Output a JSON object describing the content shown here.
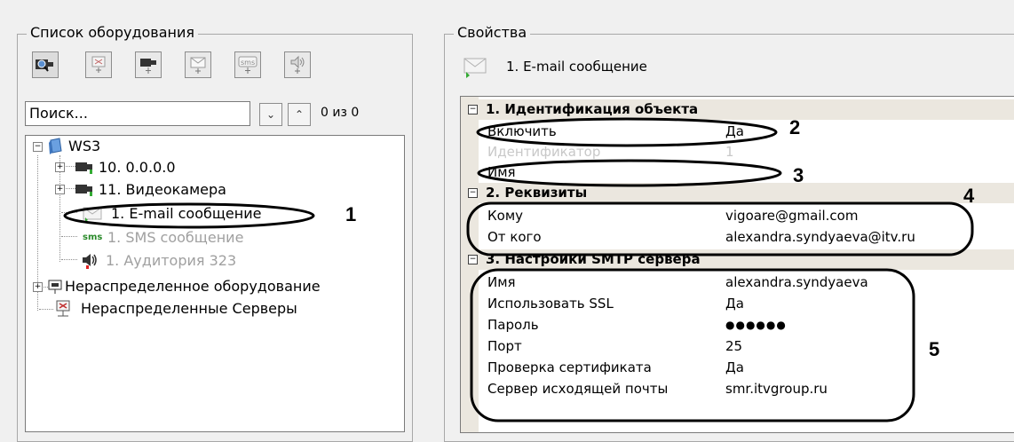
{
  "equipment": {
    "title": "Список оборудования",
    "toolbar_icons": [
      "camera-search-icon",
      "add-server-icon",
      "add-camera-icon",
      "add-email-icon",
      "add-sms-icon",
      "add-sound-icon"
    ],
    "search": {
      "value": "Поиск...",
      "count": "0 из 0"
    },
    "tree": {
      "root": "WS3",
      "items": [
        {
          "label": "10. 0.0.0.0"
        },
        {
          "label": "11. Видеокамера"
        },
        {
          "label": "1. E-mail сообщение"
        },
        {
          "label": "1. SMS сообщение"
        },
        {
          "label": "1. Аудитория 323"
        }
      ],
      "unassigned_equipment": "Нераспределенное оборудование",
      "unassigned_servers": "Нераспределенные Серверы"
    }
  },
  "properties": {
    "title": "Свойства",
    "object_title": "1. E-mail сообщение",
    "categories": [
      {
        "label": "1. Идентификация объекта",
        "rows": [
          {
            "key": "Включить",
            "value": "Да"
          },
          {
            "key": "Идентификатор",
            "value": "1"
          },
          {
            "key": "Имя",
            "value": ""
          }
        ]
      },
      {
        "label": "2. Реквизиты",
        "rows": [
          {
            "key": "Кому",
            "value": "vigoare@gmail.com"
          },
          {
            "key": "От кого",
            "value": "alexandra.syndyaeva@itv.ru"
          }
        ]
      },
      {
        "label": "3. Настройки SMTP сервера",
        "rows": [
          {
            "key": "Имя",
            "value": "alexandra.syndyaeva"
          },
          {
            "key": "Использовать SSL",
            "value": "Да"
          },
          {
            "key": "Пароль",
            "value": "●●●●●●"
          },
          {
            "key": "Порт",
            "value": "25"
          },
          {
            "key": "Проверка сертификата",
            "value": "Да"
          },
          {
            "key": "Сервер исходящей почты",
            "value": "smr.itvgroup.ru"
          }
        ]
      }
    ]
  },
  "annotations": [
    "1",
    "2",
    "3",
    "4",
    "5"
  ]
}
